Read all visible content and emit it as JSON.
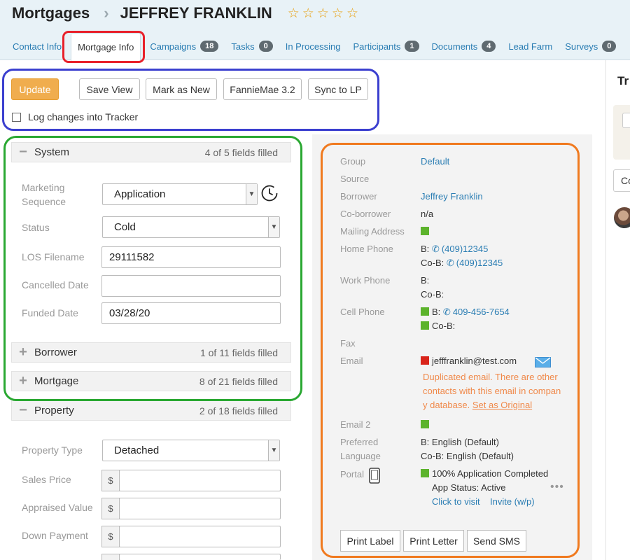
{
  "header": {
    "module": "Mortgages",
    "contact_name": "JEFFREY FRANKLIN",
    "rating_stars": 5,
    "rating_value": 0
  },
  "tabs": [
    {
      "label": "Contact Info"
    },
    {
      "label": "Mortgage Info",
      "active": true
    },
    {
      "label": "Campaigns",
      "badge": "18"
    },
    {
      "label": "Tasks",
      "badge": "0"
    },
    {
      "label": "In Processing"
    },
    {
      "label": "Participants",
      "badge": "1"
    },
    {
      "label": "Documents",
      "badge": "4"
    },
    {
      "label": "Lead Farm"
    },
    {
      "label": "Surveys",
      "badge": "0"
    }
  ],
  "toolbar": {
    "update": "Update",
    "save_view": "Save View",
    "mark_new": "Mark as New",
    "fanniemae": "FannieMae 3.2",
    "sync_lp": "Sync to LP",
    "log_changes": "Log changes into Tracker"
  },
  "sections": {
    "system": {
      "name": "System",
      "count": "4 of 5 fields filled",
      "sign": "−"
    },
    "borrower": {
      "name": "Borrower",
      "count": "1 of 11 fields filled",
      "sign": "+"
    },
    "mortgage": {
      "name": "Mortgage",
      "count": "8 of 21 fields filled",
      "sign": "+"
    },
    "property": {
      "name": "Property",
      "count": "2 of 18 fields filled",
      "sign": "−"
    }
  },
  "system_fields": {
    "marketing_sequence": {
      "label1": "Marketing",
      "label2": "Sequence",
      "value": "Application"
    },
    "status": {
      "label": "Status",
      "value": "Cold"
    },
    "los_filename": {
      "label": "LOS Filename",
      "value": "29111582"
    },
    "cancelled_date": {
      "label": "Cancelled Date",
      "value": ""
    },
    "funded_date": {
      "label": "Funded Date",
      "value": "03/28/20"
    }
  },
  "property_fields": {
    "property_type": {
      "label": "Property Type",
      "value": "Detached"
    },
    "sales_price": {
      "label": "Sales Price",
      "prefix": "$"
    },
    "appraised_value": {
      "label": "Appraised Value",
      "prefix": "$"
    },
    "down_payment": {
      "label": "Down Payment",
      "prefix": "$"
    }
  },
  "info": {
    "group": {
      "label": "Group",
      "value": "Default"
    },
    "source": {
      "label": "Source"
    },
    "borrower": {
      "label": "Borrower",
      "value": "Jeffrey Franklin"
    },
    "coborrower": {
      "label": "Co-borrower",
      "value": "n/a"
    },
    "mailing_address": {
      "label": "Mailing Address"
    },
    "home_phone": {
      "label": "Home Phone",
      "b_prefix": "B:",
      "b_value": "(409)12345",
      "cob_prefix": "Co-B:",
      "cob_value": "(409)12345"
    },
    "work_phone": {
      "label": "Work Phone",
      "b_prefix": "B:",
      "cob_prefix": "Co-B:"
    },
    "cell_phone": {
      "label": "Cell Phone",
      "b_prefix": "B:",
      "b_value": "409-456-7654",
      "cob_prefix": "Co-B:"
    },
    "fax": {
      "label": "Fax"
    },
    "email": {
      "label": "Email",
      "value": "jefffranklin@test.com",
      "warn1": "Duplicated email. There are other",
      "warn2": "contacts with this email in compan",
      "warn3": "y database.",
      "set_original": "Set as Original"
    },
    "email2": {
      "label": "Email 2"
    },
    "preferred_language": {
      "label1": "Preferred",
      "label2": "Language",
      "b": "B: English (Default)",
      "cob": "Co-B: English (Default)"
    },
    "portal": {
      "label": "Portal",
      "status": "100% Application Completed",
      "app_status": "App Status: Active",
      "click_visit": "Click to visit",
      "invite": "Invite (w/p)"
    }
  },
  "actions": {
    "print_label": "Print Label",
    "print_letter": "Print Letter",
    "send_sms": "Send SMS"
  },
  "side": {
    "title": "Tr",
    "input_value": "Co"
  },
  "colors": {
    "accent": "#2a7db3",
    "update_btn": "#f0ad4e",
    "header_bg": "#e8f2f7",
    "warning": "#f0894a",
    "ok_square": "#5cb32c",
    "error_square": "#d9241b"
  }
}
